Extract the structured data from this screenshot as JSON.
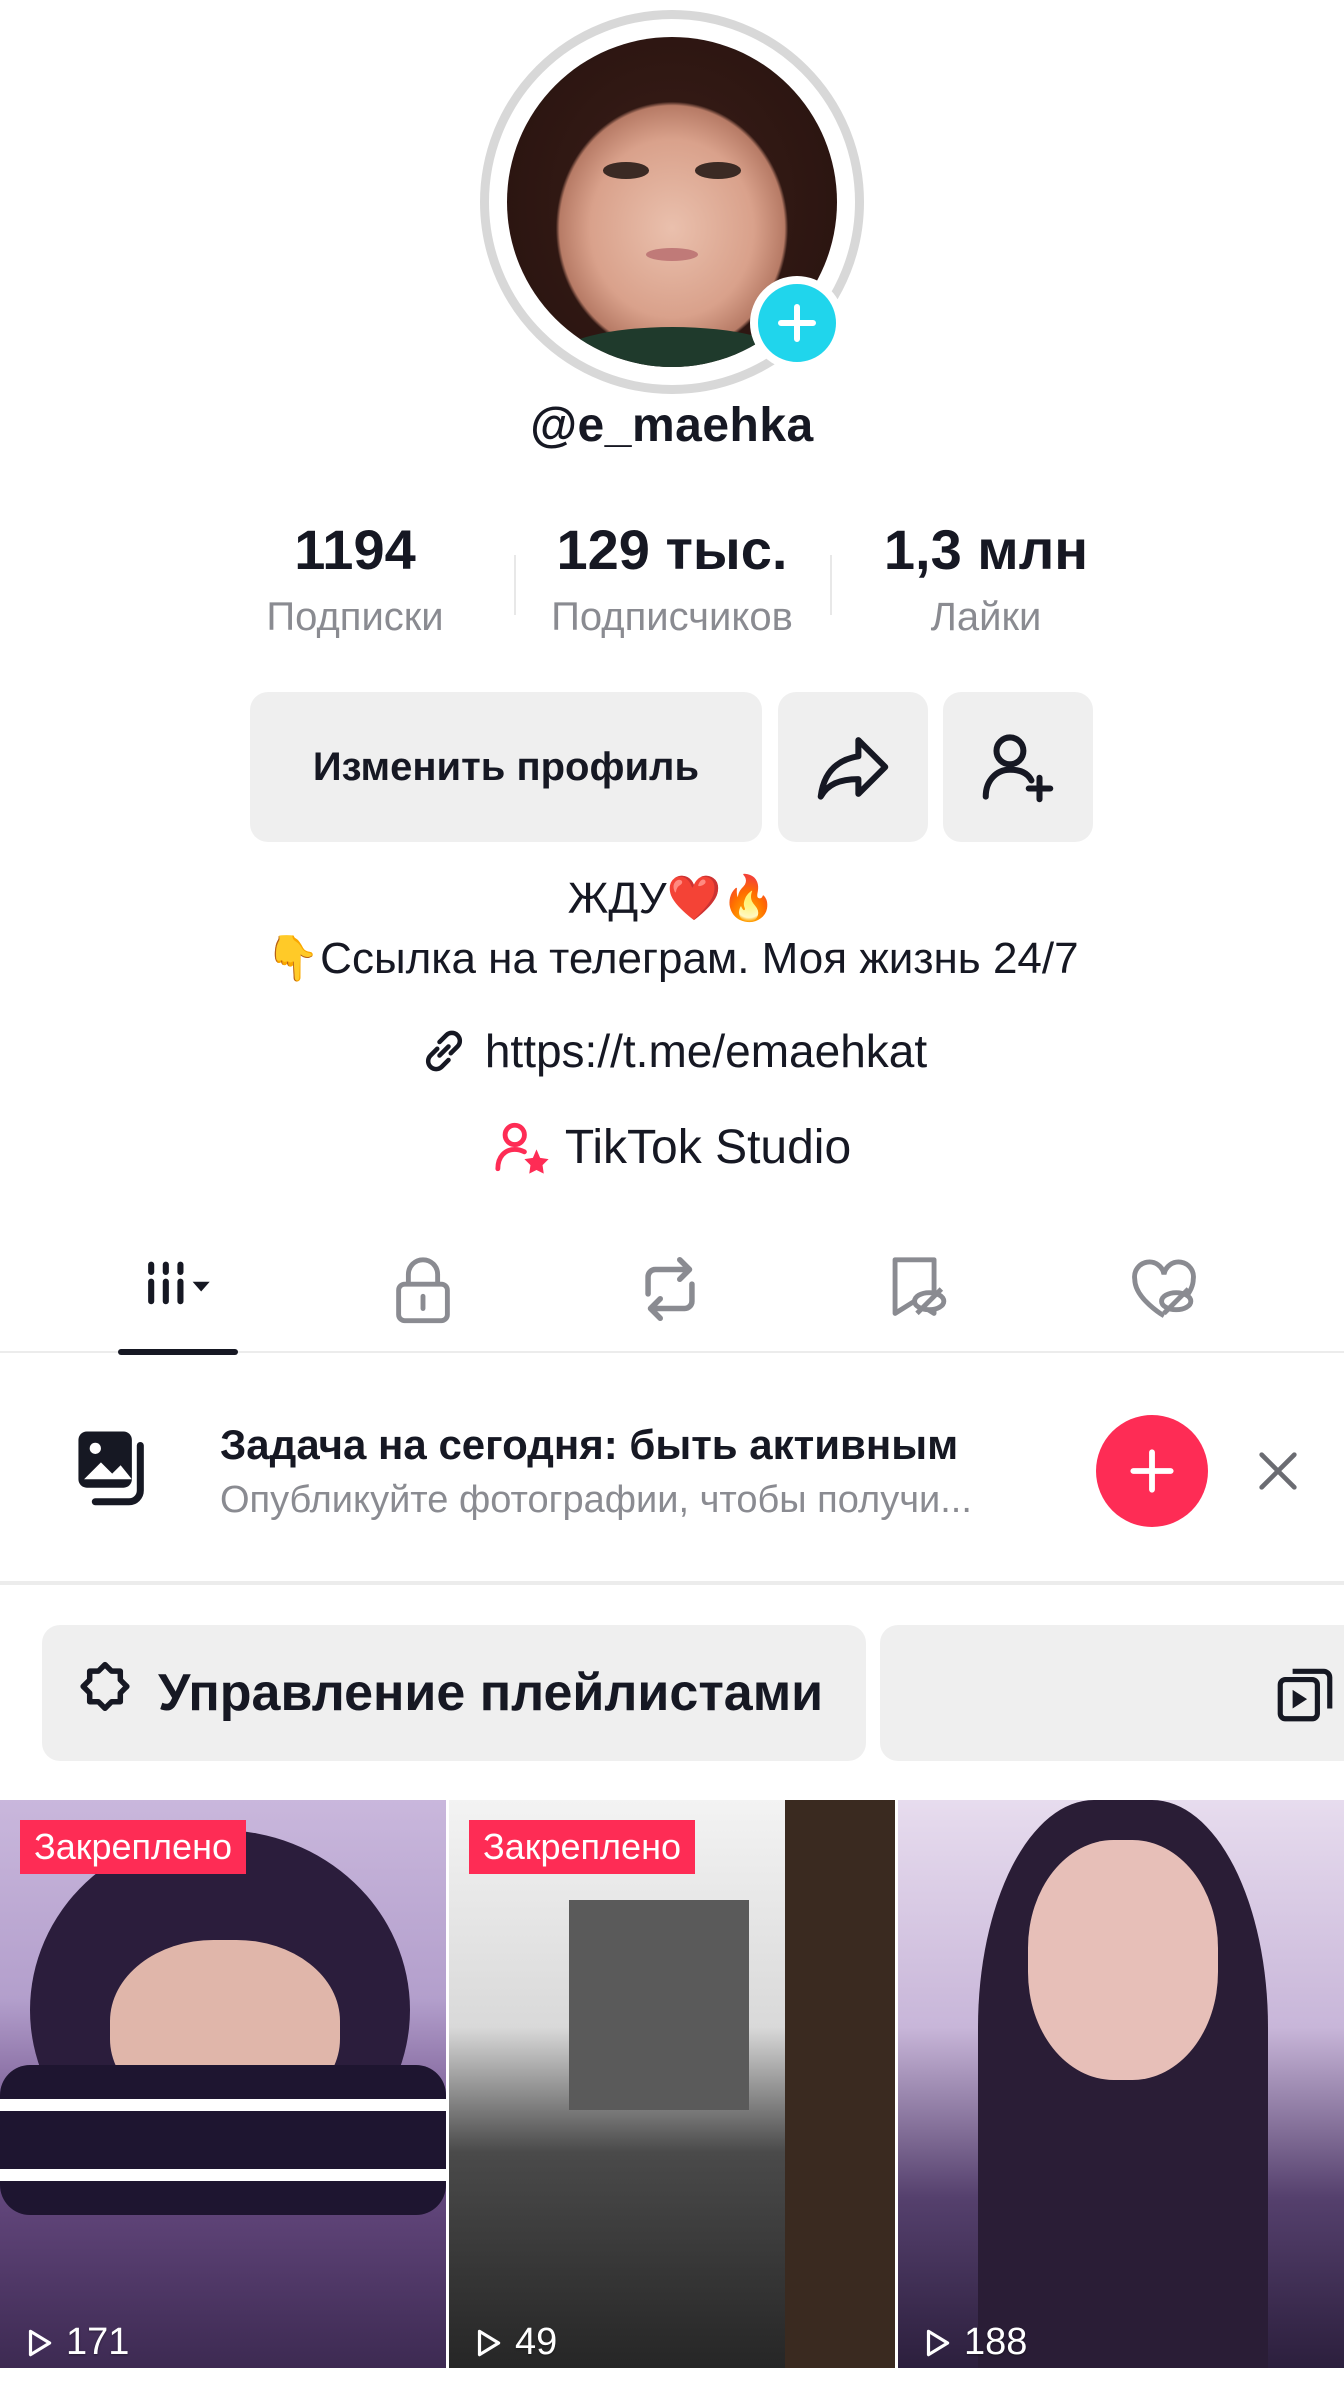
{
  "profile": {
    "username": "@e_maehka",
    "stats": {
      "following": {
        "value": "1194",
        "label": "Подписки"
      },
      "followers": {
        "value": "129 тыс.",
        "label": "Подписчиков"
      },
      "likes": {
        "value": "1,3 млн",
        "label": "Лайки"
      }
    },
    "edit_profile_label": "Изменить профиль",
    "bio_line1": "ЖДУ❤️🔥",
    "bio_line2": "👇Ссылка на телеграм. Моя жизнь 24/7",
    "link": "https://t.me/emaehkat",
    "studio_label": "TikTok Studio"
  },
  "task": {
    "title": "Задача на сегодня: быть активным",
    "subtitle": "Опубликуйте фотографии, чтобы получи..."
  },
  "playlists": {
    "manage_label": "Управление плейлистами"
  },
  "videos": [
    {
      "badge": "Закреплено",
      "views": "171"
    },
    {
      "badge": "Закреплено",
      "views": "49"
    },
    {
      "badge": "",
      "views": "188"
    }
  ],
  "colors": {
    "accent_red": "#fe2c55",
    "accent_cyan": "#20d5ec",
    "muted_text": "#8a8b91"
  }
}
